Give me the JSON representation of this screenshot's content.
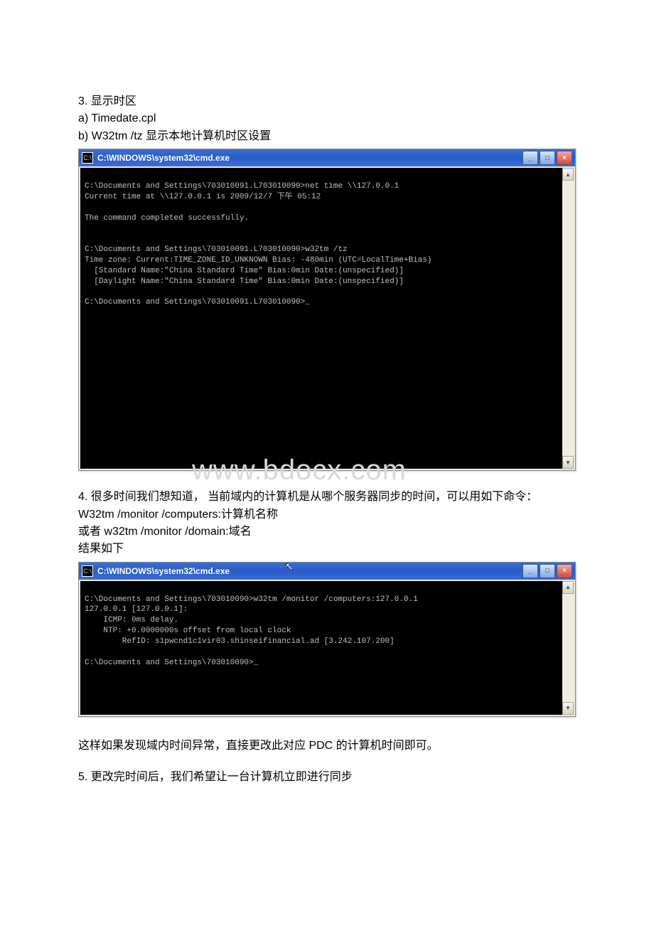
{
  "doc": {
    "line1": "3. 显示时区",
    "line2": "a)  Timedate.cpl",
    "line3": "b)  W32tm /tz  显示本地计算机时区设置",
    "line4": "4.  很多时间我们想知道，  当前域内的计算机是从哪个服务器同步的时间，可以用如下命令：",
    "line5": "W32tm /monitor /computers:计算机名称",
    "line6": "或者 w32tm /monitor /domain:域名",
    "line7": "结果如下",
    "line8": "这样如果发现域内时间异常，直接更改此对应 PDC 的计算机时间即可。",
    "line9": "5. 更改完时间后，我们希望让一台计算机立即进行同步"
  },
  "watermark": "www.bdocx.com",
  "terminal1": {
    "title": "C:\\WINDOWS\\system32\\cmd.exe",
    "content": "\nC:\\Documents and Settings\\703010091.L703010090>net time \\\\127.0.0.1\nCurrent time at \\\\127.0.0.1 is 2009/12/7 下午 05:12\n\nThe command completed successfully.\n\n\nC:\\Documents and Settings\\703010091.L703010090>w32tm /tz\nTime zone: Current:TIME_ZONE_ID_UNKNOWN Bias: -480min (UTC=LocalTime+Bias)\n  [Standard Name:\"China Standard Time\" Bias:0min Date:(unspecified)]\n  [Daylight Name:\"China Standard Time\" Bias:0min Date:(unspecified)]\n\nC:\\Documents and Settings\\703010091.L703010090>_"
  },
  "terminal2": {
    "title": "C:\\WINDOWS\\system32\\cmd.exe",
    "content": "\nC:\\Documents and Settings\\703010090>w32tm /monitor /computers:127.0.0.1\n127.0.0.1 [127.0.0.1]:\n    ICMP: 0ms delay.\n    NTP: +0.0000000s offset from local clock\n        RefID: s1pwcnd1c1vir03.shinseifinancial.ad [3.242.107.200]\n\nC:\\Documents and Settings\\703010090>_"
  },
  "buttons": {
    "min": "_",
    "max": "□",
    "close": "×",
    "up": "▲",
    "down": "▼"
  },
  "icon": "C:\\"
}
